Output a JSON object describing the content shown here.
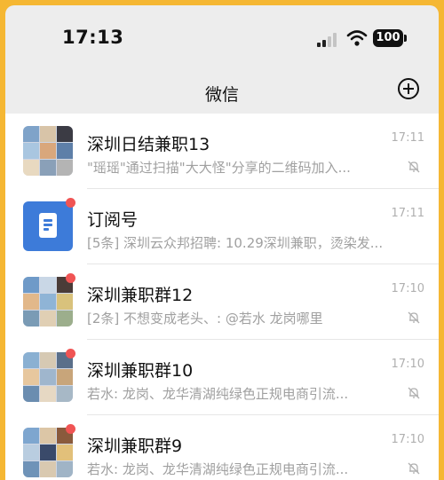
{
  "status_bar": {
    "time": "17:13",
    "battery": "100"
  },
  "nav": {
    "title": "微信"
  },
  "chats": [
    {
      "title": "深圳日结兼职13",
      "preview": "\"瑶瑶\"通过扫描\"大大怪\"分享的二维码加入...",
      "time": "17:11",
      "muted": true,
      "unread": false,
      "avatar": "group-grid"
    },
    {
      "title": "订阅号",
      "preview": "[5条] 深圳云众邦招聘: 10.29深圳兼职，烫染发...",
      "time": "17:11",
      "muted": false,
      "unread": true,
      "avatar": "subscription-doc"
    },
    {
      "title": "深圳兼职群12",
      "preview": "[2条] 不想变成老头、: @若水 龙岗哪里",
      "time": "17:10",
      "muted": true,
      "unread": true,
      "avatar": "group-grid"
    },
    {
      "title": "深圳兼职群10",
      "preview": "若水: 龙岗、龙华清湖纯绿色正规电商引流...",
      "time": "17:10",
      "muted": true,
      "unread": true,
      "avatar": "group-grid"
    },
    {
      "title": "深圳兼职群9",
      "preview": "若水: 龙岗、龙华清湖纯绿色正规电商引流...",
      "time": "17:10",
      "muted": true,
      "unread": true,
      "avatar": "group-grid"
    }
  ],
  "colors": {
    "accent_border": "#f5b733",
    "unread_dot": "#f05454",
    "subscription_blue": "#3d7bd9"
  }
}
